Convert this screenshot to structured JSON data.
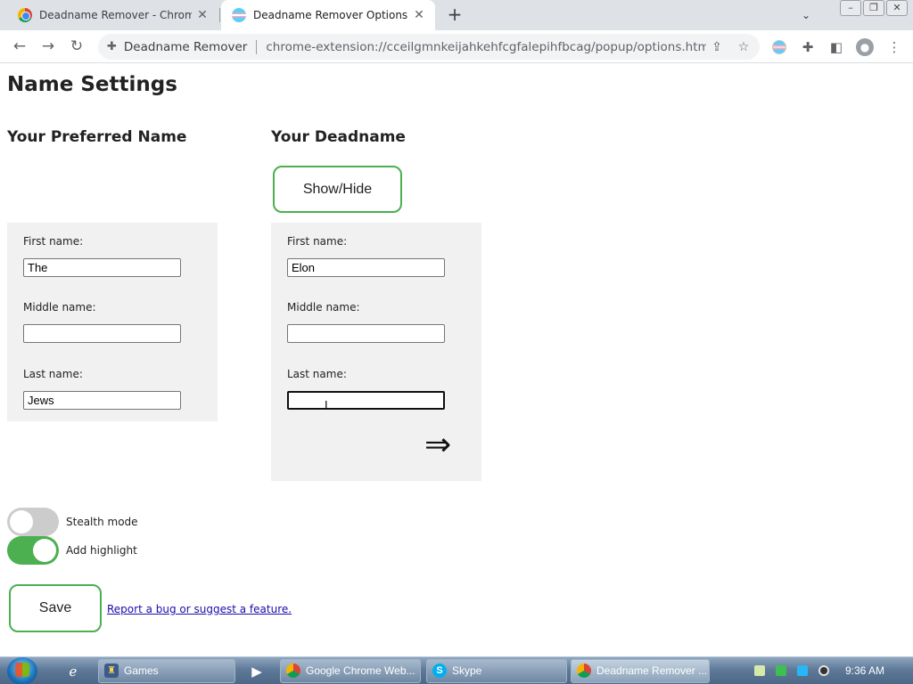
{
  "browser": {
    "tabs": [
      {
        "title": "Deadname Remover - Chrome W",
        "close": "✕"
      },
      {
        "title": "Deadname Remover Options",
        "close": "✕"
      }
    ],
    "new_tab": "+",
    "tab_search": "⌄",
    "window_controls": {
      "minimize": "–",
      "restore": "❐",
      "close": "✕"
    },
    "nav": {
      "back": "←",
      "forward": "→",
      "reload": "↻"
    },
    "omnibox": {
      "site_chip": "Deadname Remover",
      "url": "chrome-extension://cceilgmnkeijahkehfcgfalepihfbcag/popup/options.html"
    }
  },
  "page": {
    "title": "Name Settings",
    "preferred_heading": "Your Preferred Name",
    "deadname_heading": "Your Deadname",
    "show_hide_label": "Show/Hide",
    "preferred": {
      "first_label": "First name:",
      "first_value": "The",
      "middle_label": "Middle name:",
      "middle_value": "",
      "last_label": "Last name:",
      "last_value": "Jews"
    },
    "deadname": {
      "first_label": "First name:",
      "first_value": "Elon",
      "middle_label": "Middle name:",
      "middle_value": "",
      "last_label": "Last name:",
      "last_value": ""
    },
    "arrow_glyph": "⇒",
    "stealth_mode": {
      "label": "Stealth mode",
      "enabled": false
    },
    "add_highlight": {
      "label": "Add highlight",
      "enabled": true
    },
    "save_label": "Save",
    "report_link": "Report a bug or suggest a feature."
  },
  "taskbar": {
    "items": [
      {
        "label": "Games"
      },
      {
        "label": "Google Chrome Web..."
      },
      {
        "label": "Skype"
      },
      {
        "label": "Deadname Remover ..."
      }
    ],
    "clock": "9:36 AM"
  },
  "colors": {
    "accent_green": "#4caf50",
    "link": "#1a0dab",
    "panel_bg": "#f1f1f1"
  }
}
